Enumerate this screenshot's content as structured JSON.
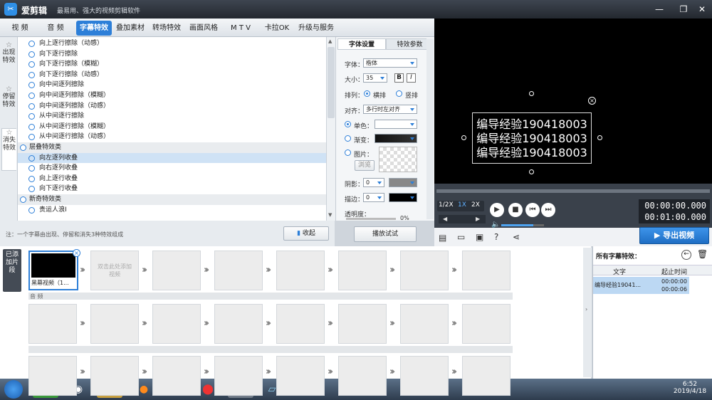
{
  "app": {
    "title": "爱剪辑",
    "subtitle": "最易用、强大的视频剪辑软件",
    "colors": {
      "accent": "#2d7fd8",
      "titlebar": "#2b3038",
      "preview_bg": "#000000"
    }
  },
  "tabs": [
    "视 频",
    "音 频",
    "字幕特效",
    "叠加素材",
    "转场特效",
    "画面风格",
    "M T V",
    "卡拉OK",
    "升级与服务"
  ],
  "active_tab": "字幕特效",
  "left_tabs": [
    {
      "label": "出现特效",
      "icon": "star-icon"
    },
    {
      "label": "停留特效",
      "icon": "star-icon"
    },
    {
      "label": "消失特效",
      "icon": "star-icon"
    }
  ],
  "effect_list": [
    {
      "text": "向上逐行擦除（动感）",
      "type": "item"
    },
    {
      "text": "向下逐行擦除",
      "type": "item"
    },
    {
      "text": "向下逐行擦除（模糊）",
      "type": "item"
    },
    {
      "text": "向下逐行擦除（动感）",
      "type": "item"
    },
    {
      "text": "向中间逐列擦除",
      "type": "item"
    },
    {
      "text": "向中间逐列擦除（模糊）",
      "type": "item"
    },
    {
      "text": "向中间逐列擦除（动感）",
      "type": "item"
    },
    {
      "text": "从中间逐行擦除",
      "type": "item"
    },
    {
      "text": "从中间逐行擦除（模糊）",
      "type": "item"
    },
    {
      "text": "从中间逐行擦除（动感）",
      "type": "item"
    },
    {
      "text": "层叠特效类",
      "type": "cat"
    },
    {
      "text": "向左逐列收叠",
      "type": "sel"
    },
    {
      "text": "向右逐列收叠",
      "type": "item"
    },
    {
      "text": "向上逐行收叠",
      "type": "item"
    },
    {
      "text": "向下逐行收叠",
      "type": "item"
    },
    {
      "text": "新奇特效类",
      "type": "cat"
    },
    {
      "text": "贵运人浪I",
      "type": "item"
    }
  ],
  "note": "注：一个字幕由出现、停留和消失3种特效组成",
  "collapse_btn": "收起",
  "play_test_btn": "播放试试",
  "settings": {
    "tab1": "字体设置",
    "tab2": "特效参数",
    "font_label": "字体：",
    "font_value": "楷体",
    "size_label": "大小：",
    "size_value": "35",
    "bold": "B",
    "italic": "I",
    "arrange_label": "排列：",
    "arrange_h": "横排",
    "arrange_v": "竖排",
    "align_label": "对齐：",
    "align_value": "多行时左对齐",
    "single_color": "单色：",
    "gradient": "渐变：",
    "image": "图片：",
    "browse": "浏览",
    "shadow_label": "阴影：",
    "shadow_value": "0",
    "stroke_label": "描边：",
    "stroke_value": "0",
    "opacity_label": "透明度：",
    "opacity_value": "0%"
  },
  "preview": {
    "lines": [
      "编导经验190418003",
      "编导经验190418003",
      "编导经验190418003"
    ]
  },
  "player": {
    "speeds": [
      "1/2X",
      "1X",
      "2X"
    ],
    "active_speed": "1X",
    "time_current": "00:00:00.000",
    "time_total": "00:01:00.000",
    "volume_fraction": 0.75
  },
  "export_btn": "导出视频",
  "timeline": {
    "label": "已添加片段",
    "first_clip": "黑幕视频（1...",
    "add_hint": "双击此处添加视频",
    "audio_label": "音 频"
  },
  "right_panel": {
    "title": "所有字幕特效：",
    "col_text": "文字",
    "col_time": "起止时间",
    "row_text": "编导经验19041...",
    "row_start": "00:00:00",
    "row_end": "00:00:06"
  },
  "taskbar": {
    "time": "6:52",
    "date": "2019/4/18"
  }
}
